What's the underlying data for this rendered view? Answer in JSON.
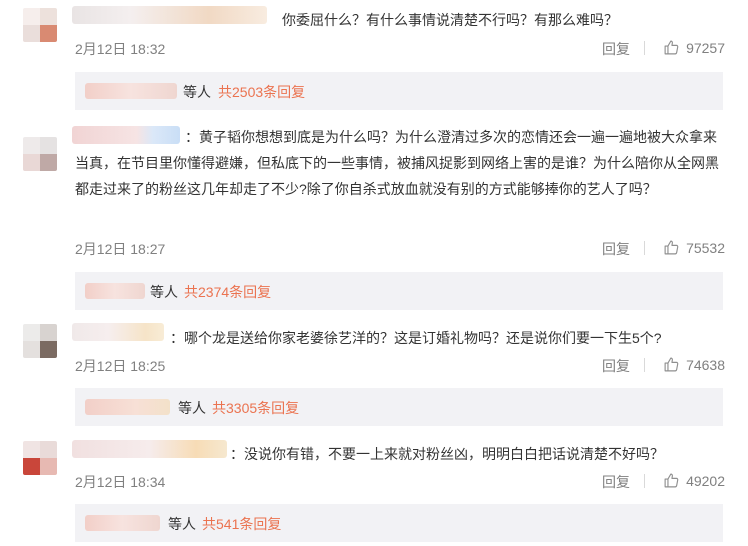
{
  "comments": [
    {
      "text": "你委屈什么？有什么事情说清楚不行吗？有那么难吗？",
      "date": "2月12日 18:32",
      "reply_label": "回复",
      "likes": "97257",
      "sub": {
        "who": "等人",
        "total": "共2503条回复"
      }
    },
    {
      "text": "：黄子韬你想想到底是为什么吗？为什么澄清过多次的恋情还会一遍一遍地被大众拿来当真，在节目里你懂得避嫌，但私底下的一些事情，被捕风捉影到网络上害的是谁？为什么陪你从全网黑都走过来了的粉丝这几年却走了不少?除了你自杀式放血就没有别的方式能够捧你的艺人了吗？",
      "date": "2月12日 18:27",
      "reply_label": "回复",
      "likes": "75532",
      "sub": {
        "who": "等人",
        "total": "共2374条回复"
      }
    },
    {
      "text": "：哪个龙是送给你家老婆徐艺洋的？这是订婚礼物吗？还是说你们要一下生5个?",
      "date": "2月12日 18:25",
      "reply_label": "回复",
      "likes": "74638",
      "sub": {
        "who": "等人",
        "total": "共3305条回复"
      }
    },
    {
      "text": "：没说你有错，不要一上来就对粉丝凶，明明白白把话说清楚不好吗？",
      "date": "2月12日 18:34",
      "reply_label": "回复",
      "likes": "49202",
      "sub": {
        "who": "等人",
        "total": "共541条回复"
      }
    }
  ],
  "icons": {
    "like": "thumbs-up-icon"
  },
  "colors": {
    "accent": "#eb7350",
    "meta": "#808080",
    "subbox": "#f2f2f5"
  }
}
